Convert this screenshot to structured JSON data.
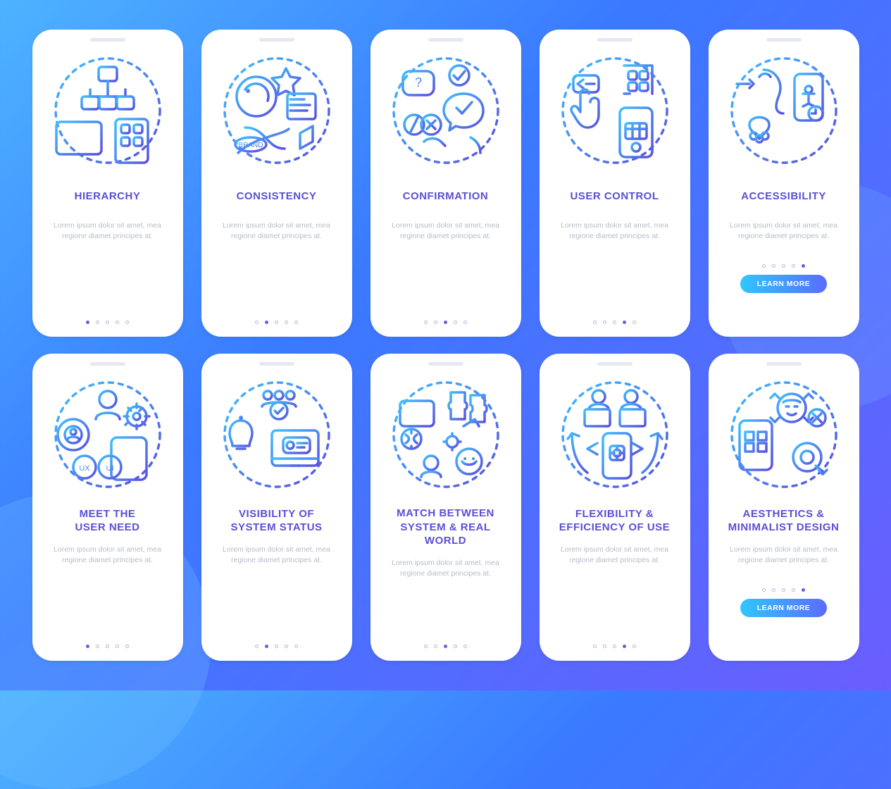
{
  "desc_text": "Lorem ipsum dolor sit amet, mea regione diamet principes at.",
  "cta_label": "LEARN MORE",
  "dots_per_card": 5,
  "cards": [
    {
      "title": "HIERARCHY",
      "active_dot": 0,
      "has_button": false,
      "icon": "hierarchy"
    },
    {
      "title": "CONSISTENCY",
      "active_dot": 1,
      "has_button": false,
      "icon": "consistency"
    },
    {
      "title": "CONFIRMATION",
      "active_dot": 2,
      "has_button": false,
      "icon": "confirmation"
    },
    {
      "title": "USER CONTROL",
      "active_dot": 3,
      "has_button": false,
      "icon": "usercontrol"
    },
    {
      "title": "ACCESSIBILITY",
      "active_dot": 4,
      "has_button": true,
      "icon": "accessibility"
    },
    {
      "title": "MEET THE\nUSER NEED",
      "active_dot": 0,
      "has_button": false,
      "icon": "userneed"
    },
    {
      "title": "VISIBILITY OF\nSYSTEM STATUS",
      "active_dot": 1,
      "has_button": false,
      "icon": "visibility"
    },
    {
      "title": "MATCH BETWEEN\nSYSTEM & REAL WORLD",
      "active_dot": 2,
      "has_button": false,
      "icon": "match"
    },
    {
      "title": "FLEXIBILITY &\nEFFICIENCY OF USE",
      "active_dot": 3,
      "has_button": false,
      "icon": "flexibility"
    },
    {
      "title": "AESTHETICS &\nMINIMALIST DESIGN",
      "active_dot": 4,
      "has_button": true,
      "icon": "aesthetics"
    }
  ]
}
